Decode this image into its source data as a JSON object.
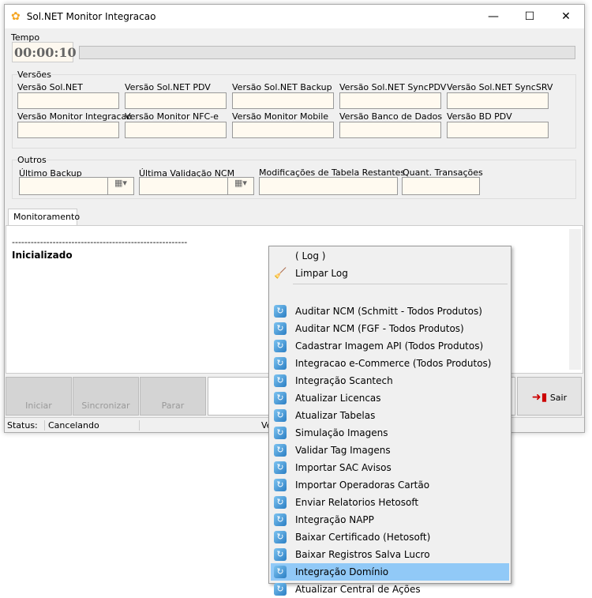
{
  "window": {
    "title": "Sol.NET Monitor Integracao",
    "minimize": "—",
    "maximize": "☐",
    "close": "✕"
  },
  "tempo": {
    "label": "Tempo",
    "value": "00:00:10",
    "progress": 0
  },
  "versoes": {
    "title": "Versões",
    "fields": [
      "Versão Sol.NET",
      "Versão Sol.NET PDV",
      "Versão Sol.NET Backup",
      "Versão Sol.NET SyncPDV",
      "Versão Sol.NET SyncSRV",
      "Versão Monitor Integracao",
      "Versão Monitor NFC-e",
      "Versão Monitor Mobile",
      "Versão Banco de Dados",
      "Versão BD PDV"
    ]
  },
  "outros": {
    "title": "Outros",
    "ultimo_backup": "Último Backup",
    "ultima_validacao": "Última Validação NCM",
    "modificacoes": "Modificações de Tabela Restantes",
    "quant": "Quant. Transações"
  },
  "tab": "Monitoramento",
  "log": {
    "line1": "--------------------------------------------------------",
    "line2": "Inicializado"
  },
  "buttons": {
    "iniciar": "Iniciar",
    "sincronizar": "Sincronizar",
    "parar": "Parar",
    "sair": "Sair"
  },
  "status": {
    "label": "Status:",
    "value": "Cancelando",
    "partial": "Ve"
  },
  "menu": {
    "items": [
      "( Log )",
      "Limpar Log",
      "Auditar NCM (Schmitt - Todos Produtos)",
      "Auditar NCM (FGF - Todos Produtos)",
      "Cadastrar Imagem API (Todos Produtos)",
      "Integracao e-Commerce (Todos Produtos)",
      "Integração Scantech",
      "Atualizar Licencas",
      "Atualizar Tabelas",
      "Simulação Imagens",
      "Validar Tag Imagens",
      "Importar SAC Avisos",
      "Importar Operadoras Cartão",
      "Enviar Relatorios Hetosoft",
      "Integração NAPP",
      "Baixar Certificado (Hetosoft)",
      "Baixar Registros Salva Lucro",
      "Integração Domínio",
      "Atualizar Central de Ações"
    ],
    "highlighted": 17
  }
}
